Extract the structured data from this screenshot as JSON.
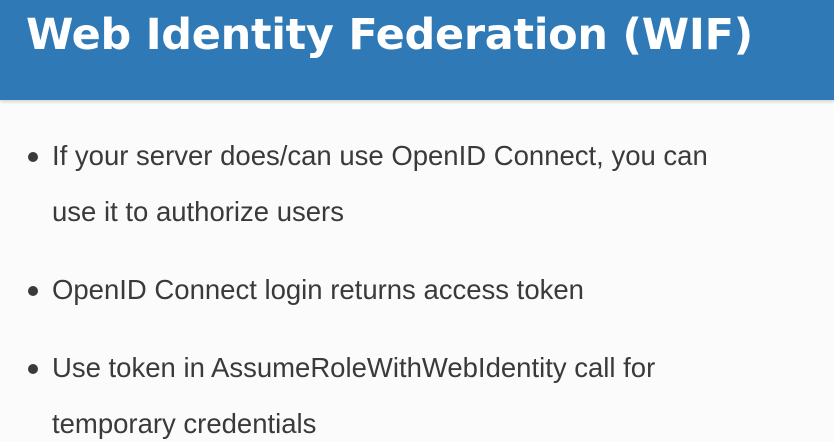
{
  "slide": {
    "title": "Web Identity Federation (WIF)",
    "bullets": [
      {
        "line1": "If your server does/can use OpenID Connect, you can",
        "line2": "use it to authorize users"
      },
      {
        "line1": "OpenID Connect login returns access token"
      },
      {
        "line1": "Use token in AssumeRoleWithWebIdentity call for",
        "line2": "temporary credentials"
      }
    ]
  },
  "colors": {
    "header_background": "#2f79b6",
    "title_text": "#ffffff",
    "body_text": "#3a3a3a",
    "slide_background": "#fbfbfb"
  }
}
